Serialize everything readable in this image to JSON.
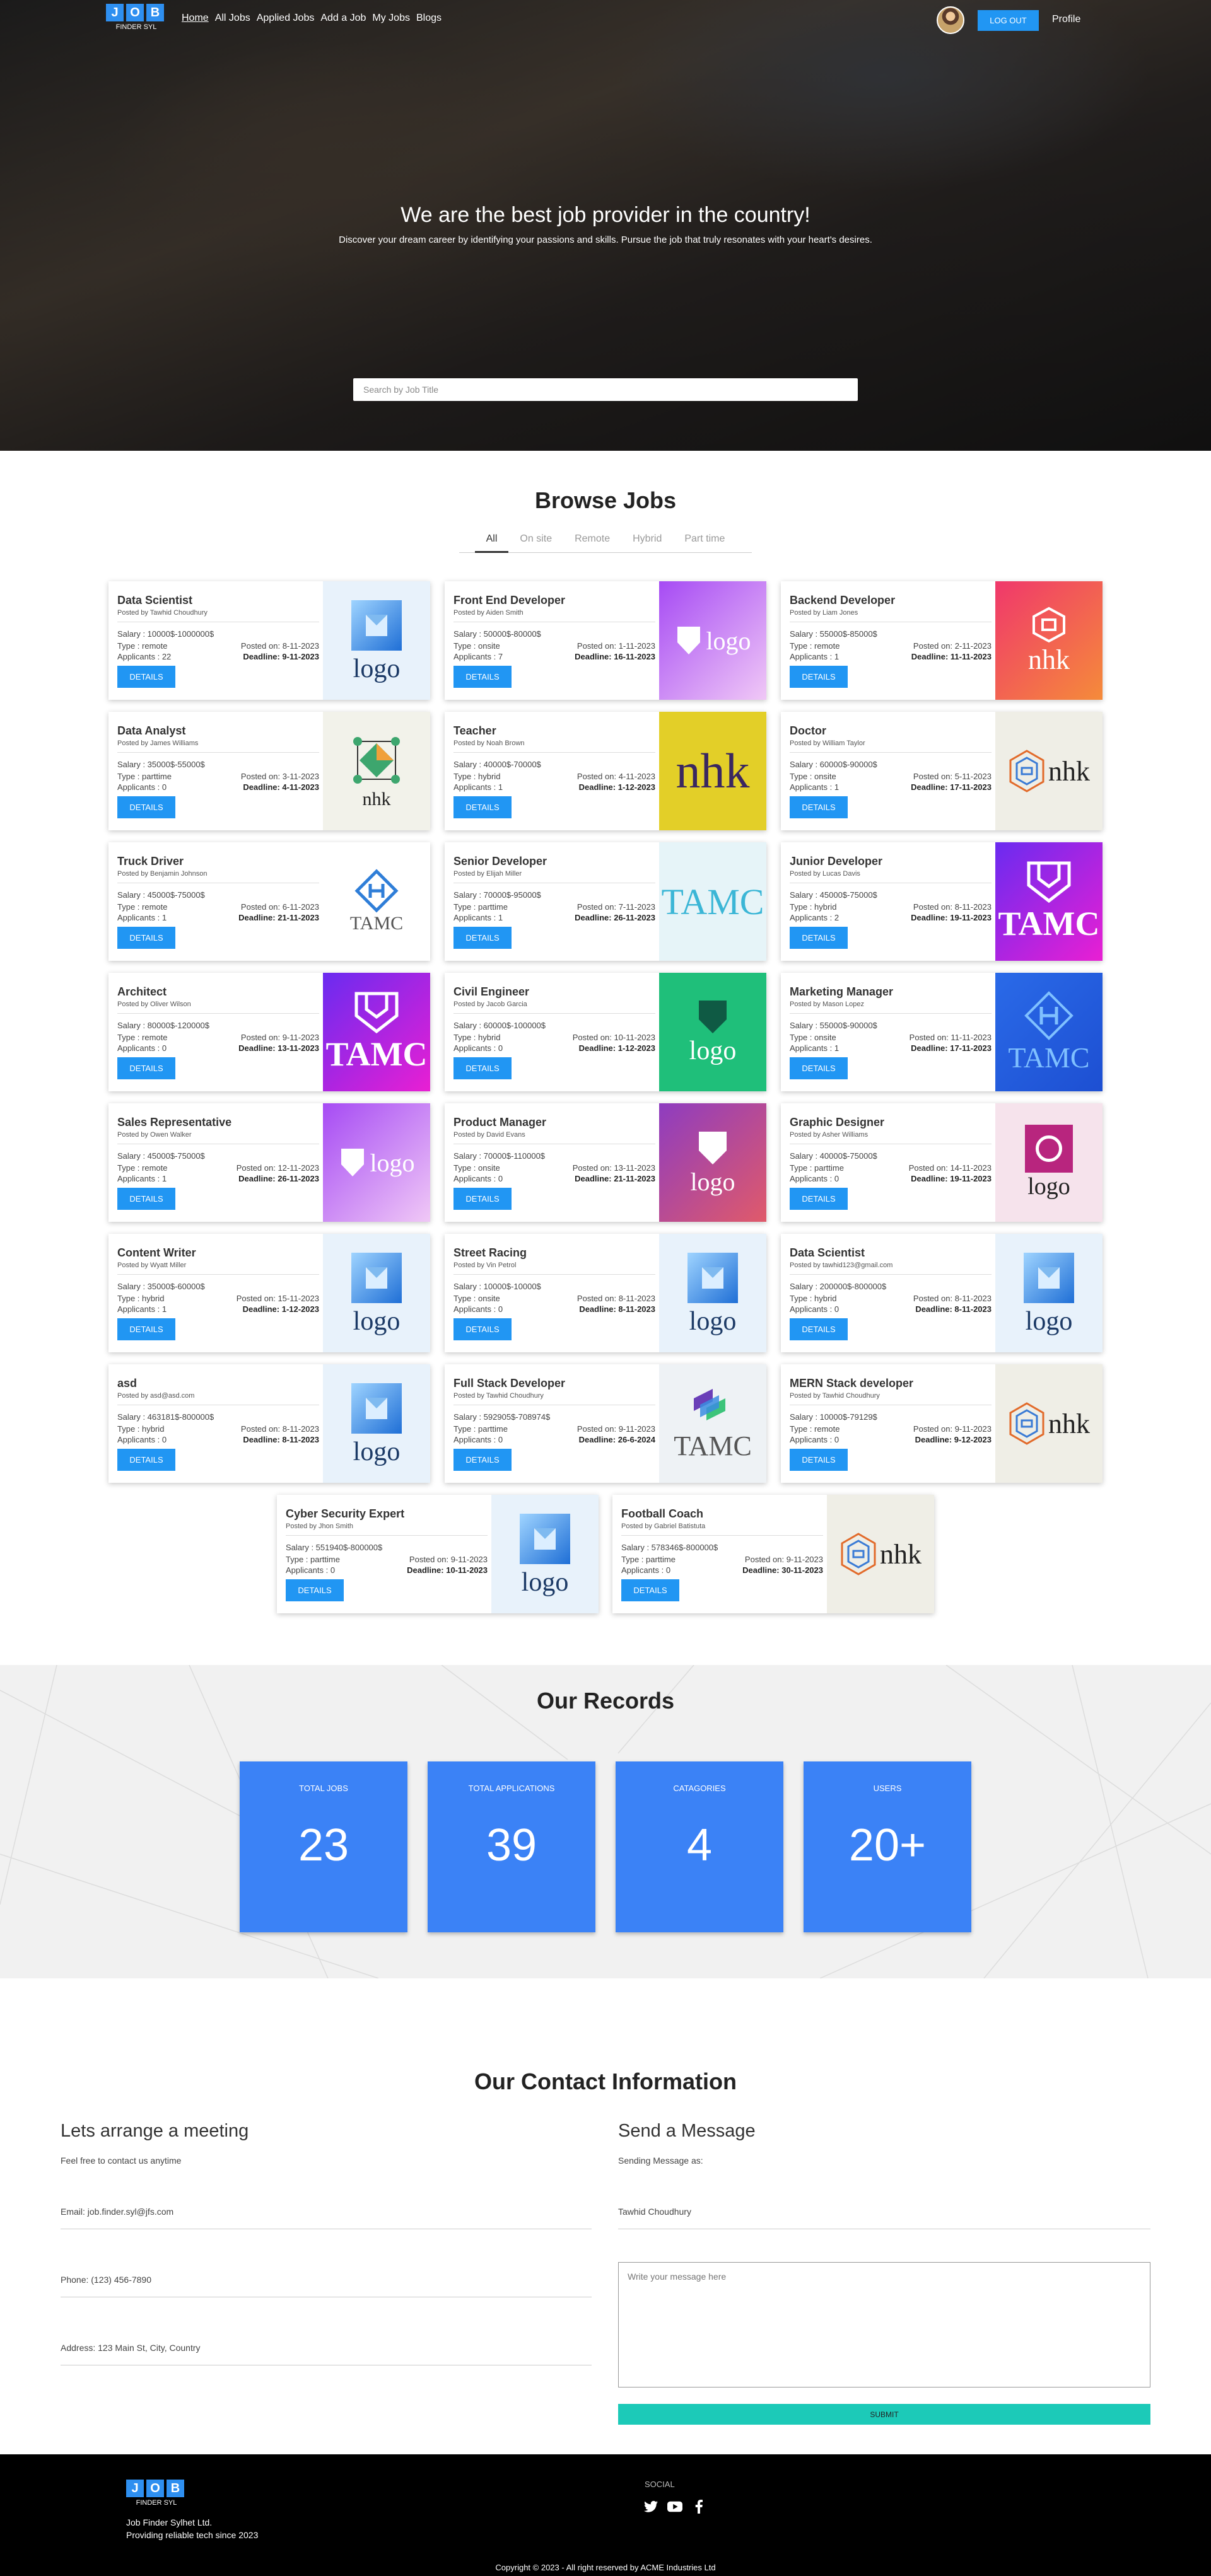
{
  "nav": {
    "logo_letters": [
      "J",
      "O",
      "B"
    ],
    "logo_sub": "FINDER SYL",
    "links": [
      "Home",
      "All Jobs",
      "Applied Jobs",
      "Add a Job",
      "My Jobs",
      "Blogs"
    ],
    "logout": "LOG OUT",
    "profile": "Profile"
  },
  "hero": {
    "title": "We are the best job provider in the country!",
    "subtitle": "Discover your dream career by identifying your passions and skills. Pursue the job that truly resonates with your heart's desires.",
    "search_placeholder": "Search by Job Title"
  },
  "browse": {
    "title": "Browse Jobs",
    "tabs": [
      "All",
      "On site",
      "Remote",
      "Hybrid",
      "Part time"
    ],
    "active_tab": "All",
    "details_label": "DETAILS",
    "jobs": [
      {
        "title": "Data Scientist",
        "poster": "Posted by Tawhid Choudhury",
        "salary": "Salary : 10000$-1000000$",
        "type": "Type : remote",
        "posted": "Posted on: 8-11-2023",
        "applicants": "Applicants : 22",
        "deadline": "Deadline: 9-11-2023",
        "logo": "logo-blue"
      },
      {
        "title": "Front End Developer",
        "poster": "Posted by Aiden Smith",
        "salary": "Salary : 50000$-80000$",
        "type": "Type : onsite",
        "posted": "Posted on: 1-11-2023",
        "applicants": "Applicants : 7",
        "deadline": "Deadline: 16-11-2023",
        "logo": "logo-purple"
      },
      {
        "title": "Backend Developer",
        "poster": "Posted by Liam Jones",
        "salary": "Salary : 55000$-85000$",
        "type": "Type : remote",
        "posted": "Posted on: 2-11-2023",
        "applicants": "Applicants : 1",
        "deadline": "Deadline: 11-11-2023",
        "logo": "nhk-pink"
      },
      {
        "title": "Data Analyst",
        "poster": "Posted by James Williams",
        "salary": "Salary : 35000$-55000$",
        "type": "Type : parttime",
        "posted": "Posted on: 3-11-2023",
        "applicants": "Applicants : 0",
        "deadline": "Deadline: 4-11-2023",
        "logo": "nhk-diamond"
      },
      {
        "title": "Teacher",
        "poster": "Posted by Noah Brown",
        "salary": "Salary : 40000$-70000$",
        "type": "Type : hybrid",
        "posted": "Posted on: 4-11-2023",
        "applicants": "Applicants : 1",
        "deadline": "Deadline: 1-12-2023",
        "logo": "nhk-yellow"
      },
      {
        "title": "Doctor",
        "poster": "Posted by William Taylor",
        "salary": "Salary : 60000$-90000$",
        "type": "Type : onsite",
        "posted": "Posted on: 5-11-2023",
        "applicants": "Applicants : 1",
        "deadline": "Deadline: 17-11-2023",
        "logo": "nhk-hex"
      },
      {
        "title": "Truck Driver",
        "poster": "Posted by Benjamin Johnson",
        "salary": "Salary : 45000$-75000$",
        "type": "Type : remote",
        "posted": "Posted on: 6-11-2023",
        "applicants": "Applicants : 1",
        "deadline": "Deadline: 21-11-2023",
        "logo": "tamc-diamond-white"
      },
      {
        "title": "Senior Developer",
        "poster": "Posted by Elijah Miller",
        "salary": "Salary : 70000$-95000$",
        "type": "Type : parttime",
        "posted": "Posted on: 7-11-2023",
        "applicants": "Applicants : 1",
        "deadline": "Deadline: 26-11-2023",
        "logo": "tamc-cyan"
      },
      {
        "title": "Junior Developer",
        "poster": "Posted by Lucas Davis",
        "salary": "Salary : 45000$-75000$",
        "type": "Type : hybrid",
        "posted": "Posted on: 8-11-2023",
        "applicants": "Applicants : 2",
        "deadline": "Deadline: 19-11-2023",
        "logo": "tamc-gradient"
      },
      {
        "title": "Architect",
        "poster": "Posted by Oliver Wilson",
        "salary": "Salary : 80000$-120000$",
        "type": "Type : remote",
        "posted": "Posted on: 9-11-2023",
        "applicants": "Applicants : 0",
        "deadline": "Deadline: 13-11-2023",
        "logo": "tamc-gradient"
      },
      {
        "title": "Civil Engineer",
        "poster": "Posted by Jacob Garcia",
        "salary": "Salary : 60000$-100000$",
        "type": "Type : hybrid",
        "posted": "Posted on: 10-11-2023",
        "applicants": "Applicants : 0",
        "deadline": "Deadline: 1-12-2023",
        "logo": "logo-green"
      },
      {
        "title": "Marketing Manager",
        "poster": "Posted by Mason Lopez",
        "salary": "Salary : 55000$-90000$",
        "type": "Type : onsite",
        "posted": "Posted on: 11-11-2023",
        "applicants": "Applicants : 1",
        "deadline": "Deadline: 17-11-2023",
        "logo": "tamc-blue"
      },
      {
        "title": "Sales Representative",
        "poster": "Posted by Owen Walker",
        "salary": "Salary : 45000$-75000$",
        "type": "Type : remote",
        "posted": "Posted on: 12-11-2023",
        "applicants": "Applicants : 1",
        "deadline": "Deadline: 26-11-2023",
        "logo": "logo-purple"
      },
      {
        "title": "Product Manager",
        "poster": "Posted by David Evans",
        "salary": "Salary : 70000$-110000$",
        "type": "Type : onsite",
        "posted": "Posted on: 13-11-2023",
        "applicants": "Applicants : 0",
        "deadline": "Deadline: 21-11-2023",
        "logo": "logo-red-gradient"
      },
      {
        "title": "Graphic Designer",
        "poster": "Posted by Asher Williams",
        "salary": "Salary : 40000$-75000$",
        "type": "Type : parttime",
        "posted": "Posted on: 14-11-2023",
        "applicants": "Applicants : 0",
        "deadline": "Deadline: 19-11-2023",
        "logo": "logo-pink-square"
      },
      {
        "title": "Content Writer",
        "poster": "Posted by Wyatt Miller",
        "salary": "Salary : 35000$-60000$",
        "type": "Type : hybrid",
        "posted": "Posted on: 15-11-2023",
        "applicants": "Applicants : 1",
        "deadline": "Deadline: 1-12-2023",
        "logo": "logo-blue"
      },
      {
        "title": "Street Racing",
        "poster": "Posted by Vin Petrol",
        "salary": "Salary : 10000$-10000$",
        "type": "Type : onsite",
        "posted": "Posted on: 8-11-2023",
        "applicants": "Applicants : 0",
        "deadline": "Deadline: 8-11-2023",
        "logo": "logo-blue"
      },
      {
        "title": "Data Scientist",
        "poster": "Posted by tawhid123@gmail.com",
        "salary": "Salary : 200000$-800000$",
        "type": "Type : hybrid",
        "posted": "Posted on: 8-11-2023",
        "applicants": "Applicants : 0",
        "deadline": "Deadline: 8-11-2023",
        "logo": "logo-blue"
      },
      {
        "title": "asd",
        "poster": "Posted by asd@asd.com",
        "salary": "Salary : 463181$-800000$",
        "type": "Type : hybrid",
        "posted": "Posted on: 8-11-2023",
        "applicants": "Applicants : 0",
        "deadline": "Deadline: 8-11-2023",
        "logo": "logo-blue"
      },
      {
        "title": "Full Stack Developer",
        "poster": "Posted by Tawhid Choudhury",
        "salary": "Salary : 592905$-708974$",
        "type": "Type : parttime",
        "posted": "Posted on: 9-11-2023",
        "applicants": "Applicants : 0",
        "deadline": "Deadline: 26-6-2024",
        "logo": "tamc-stacked"
      },
      {
        "title": "MERN Stack developer",
        "poster": "Posted by Tawhid Choudhury",
        "salary": "Salary : 10000$-79129$",
        "type": "Type : remote",
        "posted": "Posted on: 9-11-2023",
        "applicants": "Applicants : 0",
        "deadline": "Deadline: 9-12-2023",
        "logo": "nhk-hex"
      },
      {
        "title": "Cyber Security Expert",
        "poster": "Posted by Jhon Smith",
        "salary": "Salary : 551940$-800000$",
        "type": "Type : parttime",
        "posted": "Posted on: 9-11-2023",
        "applicants": "Applicants : 0",
        "deadline": "Deadline: 10-11-2023",
        "logo": "logo-blue"
      },
      {
        "title": "Football Coach",
        "poster": "Posted by Gabriel Batistuta",
        "salary": "Salary : 578346$-800000$",
        "type": "Type : parttime",
        "posted": "Posted on: 9-11-2023",
        "applicants": "Applicants : 0",
        "deadline": "Deadline: 30-11-2023",
        "logo": "nhk-hex"
      }
    ]
  },
  "records": {
    "title": "Our Records",
    "items": [
      {
        "label": "TOTAL JOBS",
        "value": "23"
      },
      {
        "label": "TOTAL APPLICATIONS",
        "value": "39"
      },
      {
        "label": "CATAGORIES",
        "value": "4"
      },
      {
        "label": "USERS",
        "value": "20+"
      }
    ]
  },
  "contact": {
    "title": "Our Contact Information",
    "left_title": "Lets arrange a meeting",
    "left_sub": "Feel free to contact us anytime",
    "email": "Email: job.finder.syl@jfs.com",
    "phone": "Phone: (123) 456-7890",
    "address": "Address: 123 Main St, City, Country",
    "right_title": "Send a Message",
    "right_sub": "Sending Message as:",
    "sender": "Tawhid Choudhury",
    "message_placeholder": "Write your message here",
    "submit": "SUBMIT"
  },
  "footer": {
    "company": "Job Finder Sylhet Ltd.",
    "tagline": "Providing reliable tech since 2023",
    "social_label": "SOCIAL",
    "copyright": "Copyright © 2023 - All right reserved by ACME Industries Ltd"
  },
  "colors": {
    "primary": "#2196f3",
    "records_card": "#3b82f6",
    "submit": "#1ccab8"
  }
}
